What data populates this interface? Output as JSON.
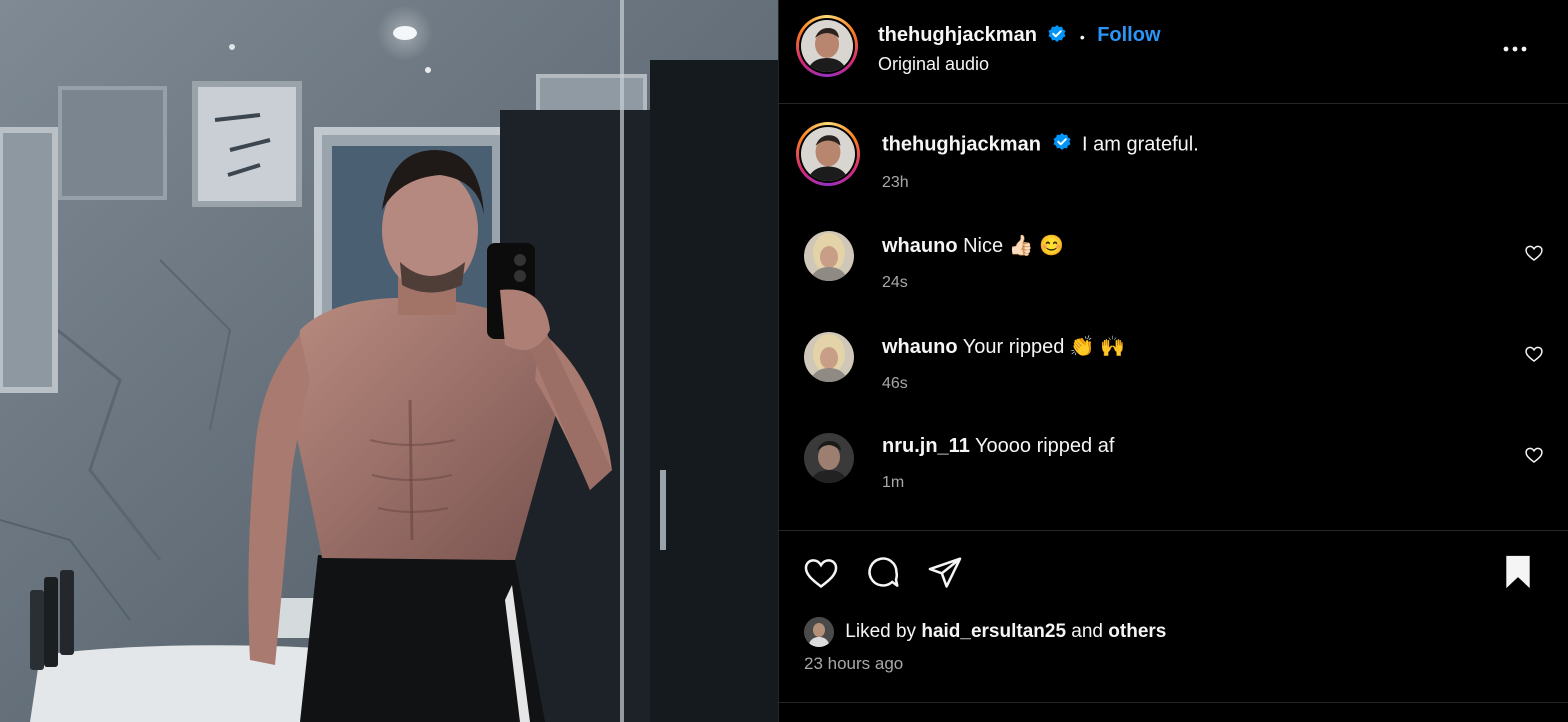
{
  "post": {
    "author": "thehughjackman",
    "follow_label": "Follow",
    "audio_label": "Original audio",
    "caption": "I am grateful.",
    "caption_time": "23h"
  },
  "comments": [
    {
      "user": "whauno",
      "text": "Nice 👍🏻 😊",
      "time": "24s"
    },
    {
      "user": "whauno",
      "text": "Your ripped 👏 🙌",
      "time": "46s"
    },
    {
      "user": "nru.jn_11",
      "text": "Yoooo ripped af",
      "time": "1m"
    }
  ],
  "likes": {
    "prefix": "Liked by",
    "user": "haid_ersultan25",
    "connector": "and",
    "others": "others"
  },
  "timestamp": "23 hours ago",
  "colors": {
    "accent": "#2b95f6",
    "verified": "#0095f6",
    "secondary_text": "#a8a8a8",
    "divider": "#262626"
  },
  "icons": [
    "verified-badge-icon",
    "more-options-icon",
    "heart-icon",
    "comment-icon",
    "share-icon",
    "bookmark-icon"
  ]
}
